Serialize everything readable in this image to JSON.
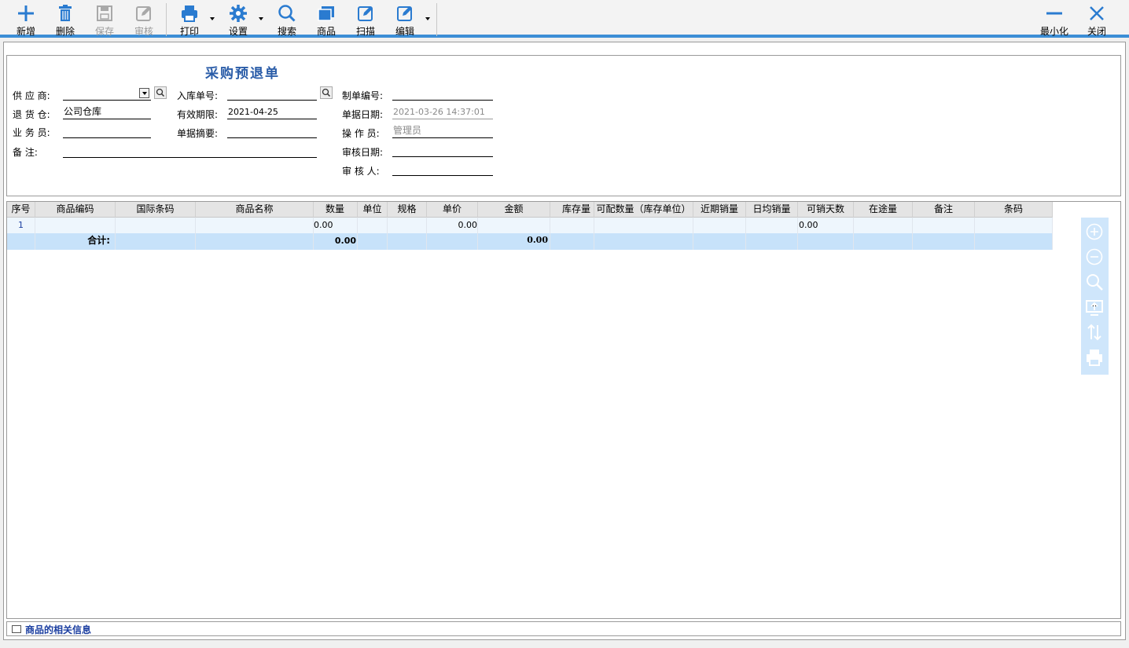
{
  "toolbar": {
    "buttons": [
      {
        "label": "新增",
        "icon": "plus-icon"
      },
      {
        "label": "删除",
        "icon": "trash-icon"
      },
      {
        "label": "保存",
        "icon": "save-icon",
        "disabled": true
      },
      {
        "label": "审核",
        "icon": "edit-icon",
        "disabled": true
      },
      {
        "label": "打印",
        "icon": "printer-icon"
      },
      {
        "label": "设置",
        "icon": "gear-icon"
      },
      {
        "label": "搜索",
        "icon": "search-icon"
      },
      {
        "label": "商品",
        "icon": "window-icon"
      },
      {
        "label": "扫描",
        "icon": "edit-icon"
      },
      {
        "label": "编辑",
        "icon": "edit-icon"
      }
    ],
    "minimize": "最小化",
    "close": "关闭",
    "accent": "#3c8ed6"
  },
  "form": {
    "title": "采购预退单",
    "supplier_label": "供 应 商:",
    "supplier_value": "",
    "warehouse_label": "退 货 仓:",
    "warehouse_value": "公司仓库",
    "salesman_label": "业 务 员:",
    "salesman_value": "",
    "remark_label": "备     注:",
    "remark_value": "",
    "receipt_no_label": "入库单号:",
    "receipt_no_value": "",
    "valid_label": "有效期限:",
    "valid_value": "2021-04-25",
    "summary_label": "单据摘要:",
    "summary_value": "",
    "doc_no_label": "制单编号:",
    "doc_no_value": "",
    "doc_date_label": "单据日期:",
    "doc_date_value": "2021-03-26 14:37:01",
    "operator_label": "操 作 员:",
    "operator_value": "管理员",
    "audit_date_label": "审核日期:",
    "audit_date_value": "",
    "auditor_label": "审 核 人:",
    "auditor_value": ""
  },
  "grid": {
    "columns": [
      "序号",
      "商品编码",
      "国际条码",
      "商品名称",
      "数量",
      "单位",
      "规格",
      "单价",
      "金额",
      "库存量",
      "可配数量（库存单位）",
      "近期销量",
      "日均销量",
      "可销天数",
      "在途量",
      "备注",
      "条码"
    ],
    "row": {
      "index": "1",
      "qty": "0.00",
      "price": "0.00",
      "days": "0.00"
    },
    "summary": {
      "label": "合计:",
      "qty": "0.00",
      "amount": "0.00"
    },
    "row_color": "#eef6fd",
    "summary_color": "#c7e2fa"
  },
  "side_tools": [
    "zoom-in-icon",
    "zoom-out-icon",
    "search-icon",
    "monitor-icon",
    "sort-icon",
    "printer-icon"
  ],
  "footer": {
    "label": "商品的相关信息"
  }
}
